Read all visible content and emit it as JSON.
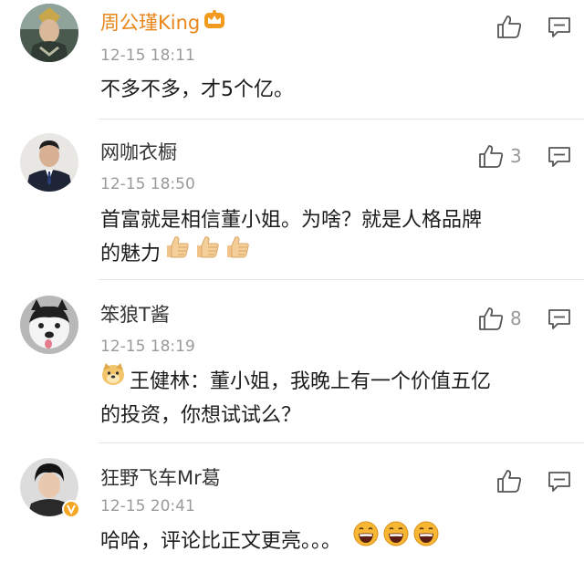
{
  "comments": [
    {
      "username": "周公瑾King",
      "time": "12-15 18:11",
      "lines": [
        "不多不多，才5个亿。"
      ],
      "likes": ""
    },
    {
      "username": "网咖衣橱",
      "time": "12-15 18:50",
      "lines": [
        "首富就是相信董小姐。为啥？就是人格品牌",
        "的魅力"
      ],
      "likes": "3"
    },
    {
      "username": "笨狼T酱",
      "time": "12-15 18:19",
      "lines": [
        "王健林：董小姐，我晚上有一个价值五亿",
        "的投资，你想试试么？"
      ],
      "likes": "8"
    },
    {
      "username": "狂野飞车Mr葛",
      "time": "12-15 20:41",
      "lines": [
        "哈哈，评论比正文更亮。。。"
      ],
      "likes": ""
    }
  ],
  "icons": {
    "like": "thumbs-up-outline-icon",
    "reply": "comment-bubble-icon",
    "thumb_emoji": "thumbs-up-emoji",
    "laugh_emoji": "grinning-face-emoji",
    "doge_emoji": "doge-emoji",
    "vip_badge": "crown-vip-icon",
    "verified_badge": "verified-v-icon"
  },
  "colors": {
    "vip_name": "#e8861a",
    "timestamp": "#9a9a9a",
    "divider": "#e4e4e4",
    "verified": "#f5a623"
  }
}
